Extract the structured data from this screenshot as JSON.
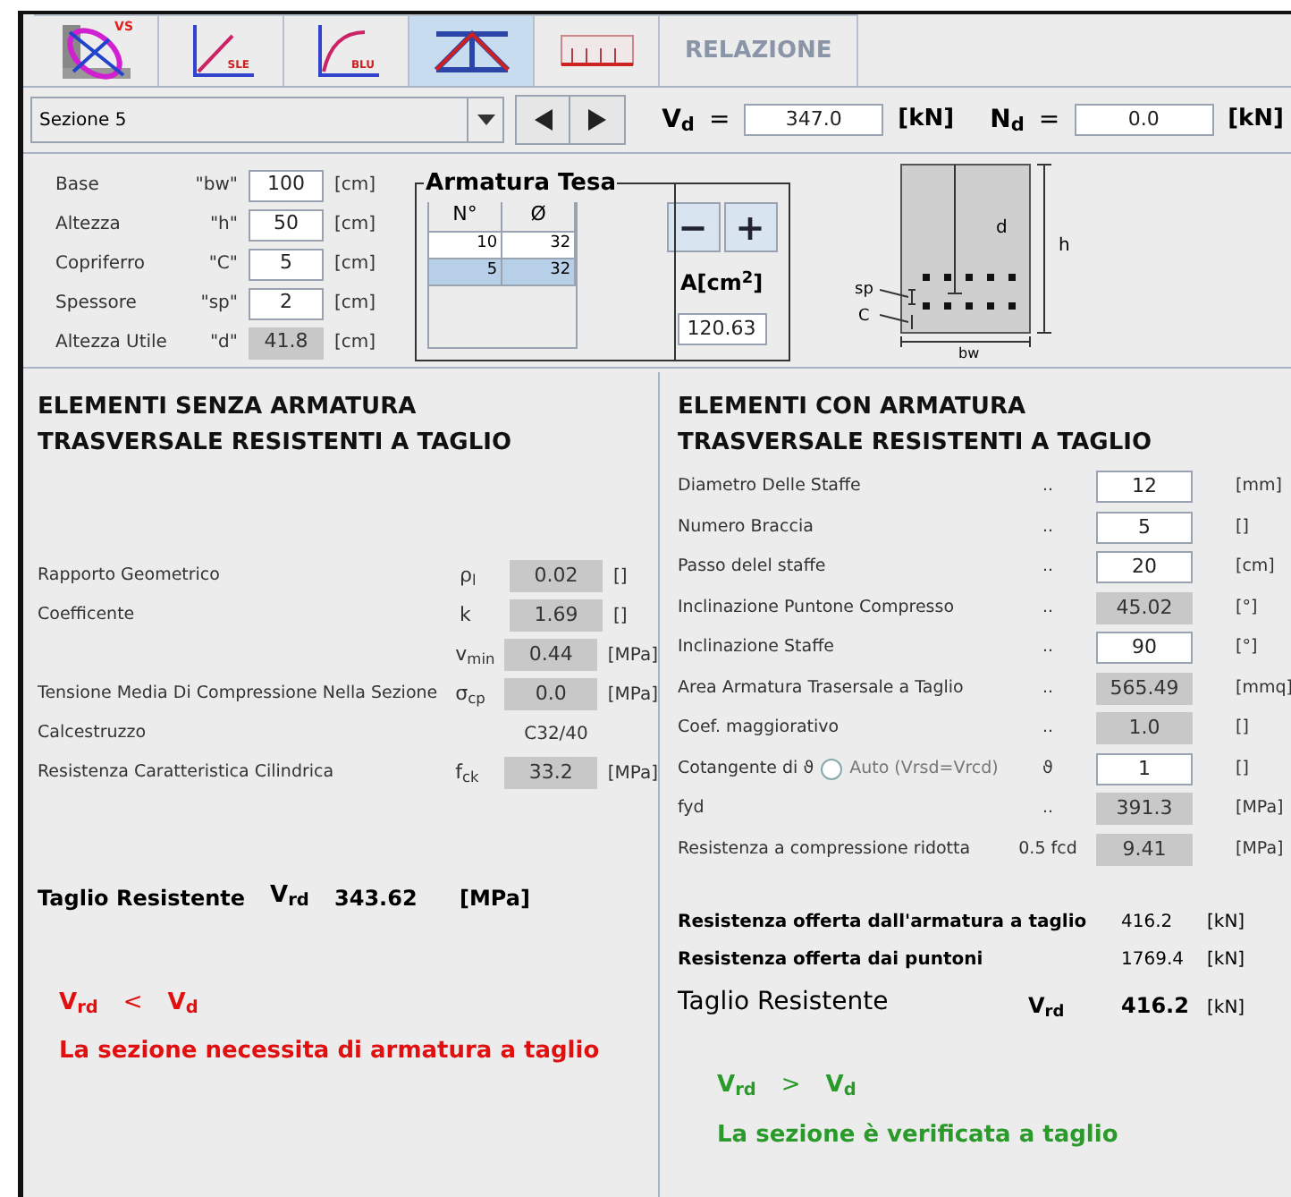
{
  "tabs": [
    {
      "kind": "vs",
      "label": "VS",
      "selected": false
    },
    {
      "kind": "sle",
      "label": "SLE",
      "selected": false
    },
    {
      "kind": "blu",
      "label": "BLU",
      "selected": false
    },
    {
      "kind": "truss",
      "selected": true
    },
    {
      "kind": "beam",
      "selected": false
    },
    {
      "kind": "text",
      "label": "RELAZIONE",
      "selected": false
    }
  ],
  "toolbar": {
    "section": "Sezione 5",
    "forces": [
      {
        "symbol": "V$_{d}$",
        "eq": "=",
        "value": "347.0",
        "unit": "[kN]"
      },
      {
        "symbol": "N$_{d}$",
        "eq": "=",
        "value": "0.0",
        "unit": "[kN]"
      }
    ]
  },
  "geometry": [
    {
      "label": "Base",
      "symbol": "\"bw\"",
      "value": "100",
      "unit": "[cm]",
      "disabled": false
    },
    {
      "label": "Altezza",
      "symbol": "\"h\"",
      "value": "50",
      "unit": "[cm]",
      "disabled": false
    },
    {
      "label": "Copriferro",
      "symbol": "\"C\"",
      "value": "5",
      "unit": "[cm]",
      "disabled": false
    },
    {
      "label": "Spessore",
      "symbol": "\"sp\"",
      "value": "2",
      "unit": "[cm]",
      "disabled": false
    },
    {
      "label": "Altezza Utile",
      "symbol": "\"d\"",
      "value": "41.8",
      "unit": "[cm]",
      "disabled": true
    }
  ],
  "armatura": {
    "title": "Armatura Tesa",
    "columns": [
      "N°",
      "Ø"
    ],
    "rows": [
      {
        "cells": [
          "10",
          "32"
        ],
        "selected": false
      },
      {
        "cells": [
          "5",
          "32"
        ],
        "selected": true
      }
    ],
    "buttons": [
      "−",
      "+"
    ],
    "area_label": "A[cm$^{2}$]",
    "area_value": "120.63"
  },
  "drawing_labels": {
    "d": "d",
    "h": "h",
    "sp": "sp",
    "c": "C",
    "bw": "bw"
  },
  "left": {
    "title": [
      "ELEMENTI SENZA ARMATURA",
      "TRASVERSALE RESISTENTI A TAGLIO"
    ],
    "rows": [
      {
        "kind": "field",
        "label": "Rapporto Geometrico",
        "symbol": "ρ$_{l}$",
        "value": "0.02",
        "unit": "[]"
      },
      {
        "kind": "field",
        "label": "Coefficente",
        "symbol": "k",
        "value": "1.69",
        "unit": "[]"
      },
      {
        "kind": "field",
        "symbol": "v$_{min}$",
        "value": "0.44",
        "unit": "[MPa]"
      },
      {
        "kind": "field",
        "label": "Tensione Media Di Compressione Nella Sezione",
        "symbol": "σ$_{cp}$",
        "value": "0.0",
        "unit": "[MPa]"
      },
      {
        "kind": "text",
        "label": "Calcestruzzo",
        "value": "C32/40"
      },
      {
        "kind": "field",
        "label": "Resistenza Caratteristica Cilindrica",
        "symbol": "f$_{ck}$",
        "value": "33.2",
        "unit": "[MPa]"
      }
    ],
    "result": {
      "label": "Taglio Resistente",
      "symbol": "V$_{rd}$",
      "value": "343.62",
      "unit": "[MPa]"
    },
    "verdict": {
      "passed": false,
      "lhs": "V$_{rd}$",
      "op": "<",
      "rhs": "V$_{d}$",
      "message": "La sezione necessita di armatura a taglio"
    }
  },
  "right": {
    "title": [
      "ELEMENTI CON ARMATURA",
      "TRASVERSALE RESISTENTI A TAGLIO"
    ],
    "rows": [
      {
        "kind": "field",
        "label": "Diametro Delle Staffe",
        "symbol": "..",
        "value": "12",
        "unit": "[mm]",
        "disabled": false
      },
      {
        "kind": "field",
        "label": "Numero Braccia",
        "symbol": "..",
        "value": "5",
        "unit": "[]",
        "disabled": false
      },
      {
        "kind": "field",
        "label": "Passo delel staffe",
        "symbol": "..",
        "value": "20",
        "unit": "[cm]",
        "disabled": false
      },
      {
        "kind": "field",
        "label": "Inclinazione Puntone Compresso",
        "symbol": "..",
        "value": "45.02",
        "unit": "[°]",
        "disabled": true
      },
      {
        "kind": "field",
        "label": "Inclinazione Staffe",
        "symbol": "..",
        "value": "90",
        "unit": "[°]",
        "disabled": false
      },
      {
        "kind": "field",
        "label": "Area Armatura Trasersale a Taglio",
        "symbol": "..",
        "value": "565.49",
        "unit": "[mmq]",
        "disabled": true
      },
      {
        "kind": "field",
        "label": "Coef. maggiorativo",
        "symbol": "..",
        "value": "1.0",
        "unit": "[]",
        "disabled": true
      },
      {
        "kind": "radio",
        "label": "Cotangente di ϑ",
        "radio_label": "Auto (Vrsd=Vrcd)",
        "checked": false,
        "symbol": "ϑ",
        "value": "1",
        "unit": "[]",
        "disabled": false
      },
      {
        "kind": "field",
        "label": "fyd",
        "symbol": "..",
        "value": "391.3",
        "unit": "[MPa]",
        "disabled": true
      },
      {
        "kind": "field",
        "label": "Resistenza a compressione ridotta",
        "symbol": "0.5 fcd",
        "value": "9.41",
        "unit": "[MPa]",
        "disabled": true
      }
    ],
    "results": [
      {
        "label": "Resistenza offerta dall'armatura a taglio",
        "value": "416.2",
        "unit": "[kN]"
      },
      {
        "label": "Resistenza offerta dai puntoni",
        "value": "1769.4",
        "unit": "[kN]"
      }
    ],
    "result": {
      "label": "Taglio Resistente",
      "symbol": "V$_{rd}$",
      "value": "416.2",
      "unit": "[kN]"
    },
    "verdict": {
      "passed": true,
      "lhs": "V$_{rd}$",
      "op": ">",
      "rhs": "V$_{d}$",
      "message": "La sezione è verificata a taglio"
    }
  }
}
